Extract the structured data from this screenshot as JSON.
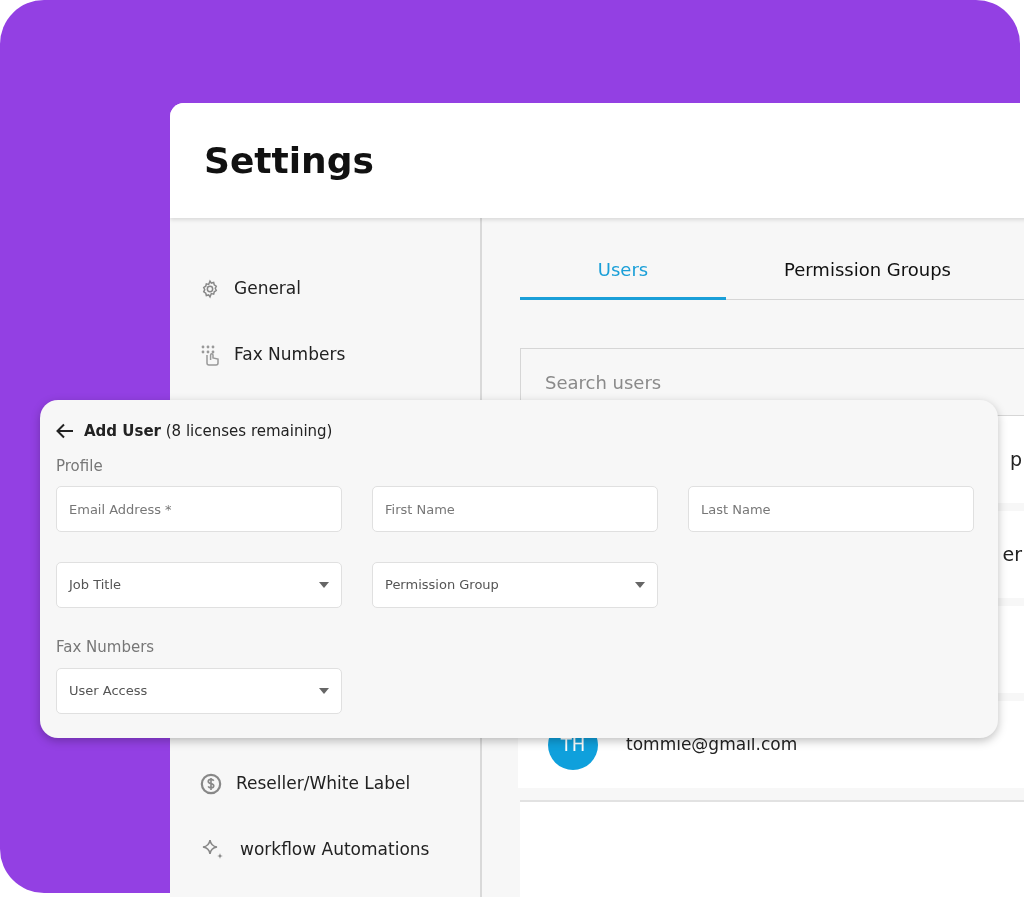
{
  "window": {
    "title": "Settings"
  },
  "sidebar": {
    "items": [
      {
        "label": "General"
      },
      {
        "label": "Fax Numbers"
      },
      {
        "label": "Reseller/White Label"
      },
      {
        "label": "workflow Automations"
      }
    ]
  },
  "tabs": [
    {
      "label": "Users",
      "selected": true
    },
    {
      "label": "Permission Groups",
      "selected": false
    }
  ],
  "search": {
    "placeholder": "Search users"
  },
  "user_rows": [
    {
      "column_3": "p"
    },
    {
      "column_3": "er"
    },
    {
      "initials": "TH",
      "email": "tommie@gmail.com"
    }
  ],
  "add_user_dialog": {
    "title": "**Add User** (8 licenses remaining)",
    "sections": [
      {
        "label": "Profile",
        "fields": [
          {
            "kind": "text",
            "placeholder": "Email Address *"
          },
          {
            "kind": "text",
            "placeholder": "First Name"
          },
          {
            "kind": "text",
            "placeholder": "Last Name"
          },
          {
            "kind": "select",
            "placeholder": "Job Title"
          },
          {
            "kind": "select",
            "placeholder": "Permission Group"
          }
        ]
      },
      {
        "label": "Fax Numbers",
        "fields": [
          {
            "kind": "select",
            "placeholder": "User Access"
          }
        ]
      }
    ]
  }
}
